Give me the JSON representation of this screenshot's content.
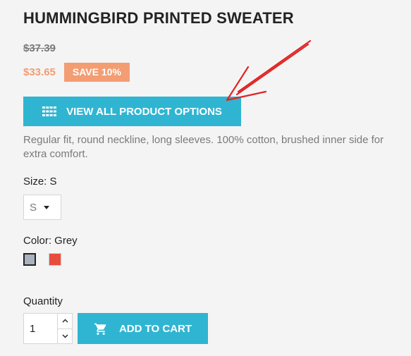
{
  "product": {
    "title": "HUMMINGBIRD PRINTED SWEATER",
    "old_price": "$37.39",
    "current_price": "$33.65",
    "discount_badge": "SAVE 10%",
    "description": "Regular fit, round neckline, long sleeves. 100% cotton, brushed inner side for extra comfort."
  },
  "options_button": {
    "label": "VIEW ALL PRODUCT OPTIONS",
    "icon": "grid-icon"
  },
  "size": {
    "label": "Size: S",
    "selected": "S"
  },
  "color": {
    "label": "Color: Grey",
    "swatches": [
      {
        "name": "Grey",
        "hex": "#aab2bd",
        "selected": true
      },
      {
        "name": "Red",
        "hex": "#e84c3d",
        "selected": false
      }
    ]
  },
  "quantity": {
    "label": "Quantity",
    "value": "1",
    "up_icon": "chevron-up-icon",
    "down_icon": "chevron-down-icon"
  },
  "add_to_cart": {
    "label": "ADD TO CART",
    "icon": "shopping-cart-icon"
  },
  "colors": {
    "accent": "#2fb5d2",
    "discount": "#f39d72",
    "annotation_arrow": "#e02424"
  }
}
